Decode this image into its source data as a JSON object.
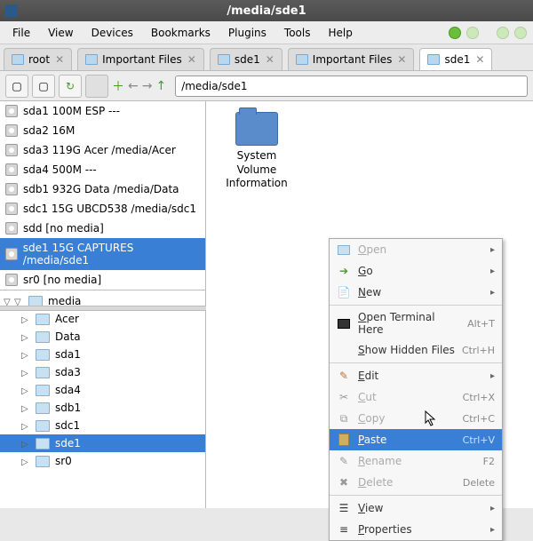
{
  "window": {
    "title": "/media/sde1"
  },
  "menu": [
    "File",
    "View",
    "Devices",
    "Bookmarks",
    "Plugins",
    "Tools",
    "Help"
  ],
  "tabs": [
    {
      "label": "root",
      "active": false
    },
    {
      "label": "Important Files",
      "active": false
    },
    {
      "label": "sde1",
      "active": false
    },
    {
      "label": "Important Files",
      "active": false
    },
    {
      "label": "sde1",
      "active": true
    }
  ],
  "path": "/media/sde1",
  "devices": [
    {
      "label": "sda1 100M ESP ---",
      "selected": false
    },
    {
      "label": "sda2 16M",
      "selected": false
    },
    {
      "label": "sda3 119G Acer /media/Acer",
      "selected": false
    },
    {
      "label": "sda4 500M ---",
      "selected": false
    },
    {
      "label": "sdb1 932G Data /media/Data",
      "selected": false
    },
    {
      "label": "sdc1 15G UBCD538 /media/sdc1",
      "selected": false
    },
    {
      "label": "sdd [no media]",
      "selected": false
    },
    {
      "label": "sde1 15G CAPTURES /media/sde1",
      "selected": true
    },
    {
      "label": "sr0 [no media]",
      "selected": false
    }
  ],
  "tree": {
    "root": "media",
    "children": [
      {
        "label": "Acer",
        "selected": false
      },
      {
        "label": "Data",
        "selected": false
      },
      {
        "label": "sda1",
        "selected": false
      },
      {
        "label": "sda3",
        "selected": false
      },
      {
        "label": "sda4",
        "selected": false
      },
      {
        "label": "sdb1",
        "selected": false
      },
      {
        "label": "sdc1",
        "selected": false
      },
      {
        "label": "sde1",
        "selected": true
      },
      {
        "label": "sr0",
        "selected": false
      }
    ]
  },
  "main_items": [
    {
      "label": "System Volume Information"
    }
  ],
  "context_menu": [
    {
      "type": "item",
      "label": "Open",
      "icon": "folder",
      "disabled": true,
      "submenu": true
    },
    {
      "type": "item",
      "label": "Go",
      "icon": "go",
      "submenu": true
    },
    {
      "type": "item",
      "label": "New",
      "icon": "new",
      "submenu": true
    },
    {
      "type": "sep"
    },
    {
      "type": "item",
      "label": "Open Terminal Here",
      "icon": "terminal",
      "shortcut": "Alt+T"
    },
    {
      "type": "item",
      "label": "Show Hidden Files",
      "shortcut": "Ctrl+H"
    },
    {
      "type": "sep"
    },
    {
      "type": "item",
      "label": "Edit",
      "icon": "edit",
      "submenu": true
    },
    {
      "type": "item",
      "label": "Cut",
      "icon": "cut",
      "disabled": true,
      "shortcut": "Ctrl+X"
    },
    {
      "type": "item",
      "label": "Copy",
      "icon": "copy",
      "disabled": true,
      "shortcut": "Ctrl+C"
    },
    {
      "type": "item",
      "label": "Paste",
      "icon": "paste",
      "selected": true,
      "shortcut": "Ctrl+V"
    },
    {
      "type": "item",
      "label": "Rename",
      "icon": "rename",
      "disabled": true,
      "shortcut": "F2"
    },
    {
      "type": "item",
      "label": "Delete",
      "icon": "delete",
      "disabled": true,
      "shortcut": "Delete"
    },
    {
      "type": "sep"
    },
    {
      "type": "item",
      "label": "View",
      "icon": "view",
      "submenu": true
    },
    {
      "type": "item",
      "label": "Properties",
      "icon": "properties",
      "submenu": true
    }
  ]
}
